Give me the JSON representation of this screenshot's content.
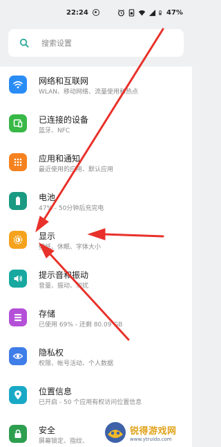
{
  "status_bar": {
    "time": "22:24",
    "battery": "47%"
  },
  "search": {
    "placeholder": "搜索设置"
  },
  "settings": {
    "items": [
      {
        "title": "网络和互联网",
        "subtitle": "WLAN、移动网络、流量使用和热点",
        "icon": "wifi-icon",
        "color": "#2a8cf5"
      },
      {
        "title": "已连接的设备",
        "subtitle": "蓝牙、NFC",
        "icon": "devices-icon",
        "color": "#38b846"
      },
      {
        "title": "应用和通知",
        "subtitle": "最近使用的应用、默认应用",
        "icon": "apps-icon",
        "color": "#f5821f"
      },
      {
        "title": "电池",
        "subtitle": "47% - 50分钟后充完电",
        "icon": "battery-icon",
        "color": "#1a9a82"
      },
      {
        "title": "显示",
        "subtitle": "壁纸、休眠、字体大小",
        "icon": "brightness-icon",
        "color": "#f5a21c"
      },
      {
        "title": "提示音和振动",
        "subtitle": "音量、振动、勿扰",
        "icon": "volume-icon",
        "color": "#17a8a0"
      },
      {
        "title": "存储",
        "subtitle": "已使用 69% - 还剩 80.09 GB",
        "icon": "storage-icon",
        "color": "#b44fd8"
      },
      {
        "title": "隐私权",
        "subtitle": "权限、帐号活动、个人数据",
        "icon": "privacy-icon",
        "color": "#3f7de8"
      },
      {
        "title": "位置信息",
        "subtitle": "已开启 - 50 个应用有权访问位置信息",
        "icon": "location-icon",
        "color": "#19a9c6"
      },
      {
        "title": "安全",
        "subtitle": "屏幕锁定、指纹、",
        "icon": "lock-icon",
        "color": "#2e9e4f"
      }
    ]
  },
  "watermark": {
    "name": "锐得游戏网",
    "url": "www.ytruido.com"
  },
  "colors": {
    "arrow": "#e8312a",
    "background": "#eef0f2"
  }
}
